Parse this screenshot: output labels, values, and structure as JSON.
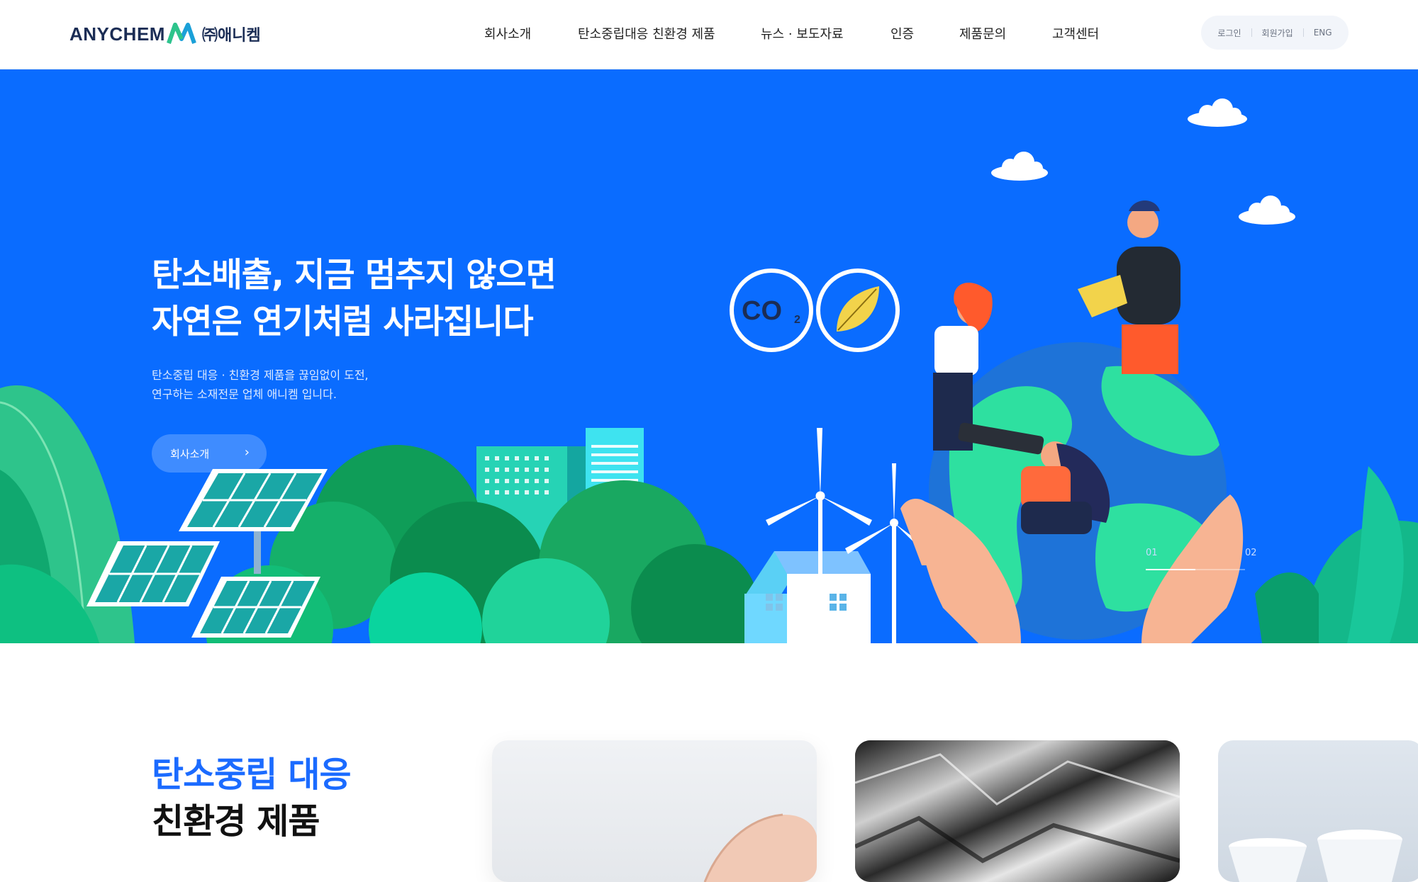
{
  "header": {
    "logo_text": "ANYCHEM",
    "logo_kr": "㈜애니켐",
    "nav": [
      "회사소개",
      "탄소중립대응 친환경 제품",
      "뉴스 · 보도자료",
      "인증",
      "제품문의",
      "고객센터"
    ],
    "util": {
      "login": "로그인",
      "signup": "회원가입",
      "lang": "ENG"
    }
  },
  "hero": {
    "title_line1": "탄소배출, 지금 멈추지 않으면",
    "title_line2": "자연은 연기처럼 사라집니다",
    "desc_line1": "탄소중립 대응 · 친환경 제품을 끊임없이 도전,",
    "desc_line2": "연구하는 소재전문 업체 애니켐 입니다.",
    "button_label": "회사소개",
    "co2_label": "CO",
    "co2_sub": "2",
    "slides": {
      "current": "01",
      "next": "02",
      "progress": 0.5
    }
  },
  "products": {
    "title_line1": "탄소중립 대응",
    "title_line2": "친환경 제품"
  },
  "colors": {
    "brand_blue": "#0a6cff",
    "navy": "#1b2d55",
    "accent_blue": "#1b6bff"
  }
}
